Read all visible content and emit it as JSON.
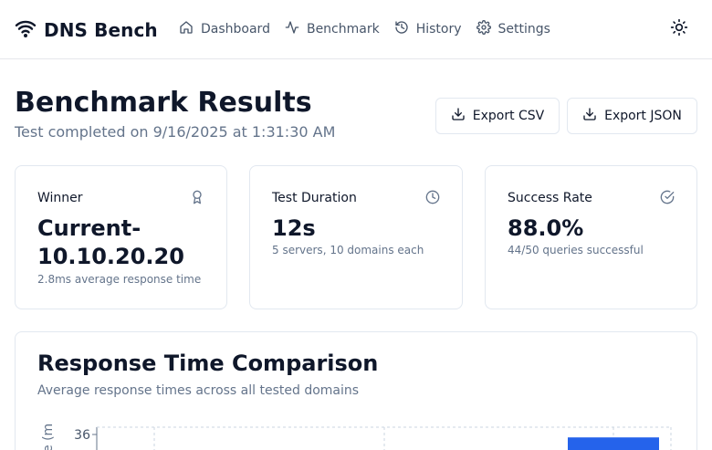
{
  "header": {
    "brand": "DNS Bench",
    "nav": [
      {
        "label": "Dashboard",
        "icon": "home-icon"
      },
      {
        "label": "Benchmark",
        "icon": "activity-icon"
      },
      {
        "label": "History",
        "icon": "history-icon"
      },
      {
        "label": "Settings",
        "icon": "gear-icon"
      }
    ],
    "theme_icon": "sun-icon"
  },
  "page": {
    "title": "Benchmark Results",
    "subtitle": "Test completed on 9/16/2025 at 1:31:30 AM"
  },
  "actions": {
    "export_csv": "Export CSV",
    "export_json": "Export JSON"
  },
  "cards": {
    "winner": {
      "label": "Winner",
      "value": "Current-10.10.20.20",
      "note": "2.8ms average response time",
      "icon": "award-icon"
    },
    "duration": {
      "label": "Test Duration",
      "value": "12s",
      "note": "5 servers, 10 domains each",
      "icon": "clock-icon"
    },
    "success": {
      "label": "Success Rate",
      "value": "88.0%",
      "note": "44/50 queries successful",
      "icon": "check-circle-icon"
    }
  },
  "chart": {
    "title": "Response Time Comparison",
    "subtitle": "Average response times across all tested domains",
    "ylabel_partial": "e (m",
    "accent_color": "#2563eb"
  },
  "chart_data": {
    "type": "bar",
    "title": "Response Time Comparison",
    "subtitle": "Average response times across all tested domains",
    "ylabel": "",
    "yticks_visible": [
      36
    ],
    "categories": [],
    "values": [],
    "partial_bar_value": 35
  },
  "colors": {
    "text_primary": "#0f172a",
    "text_muted": "#64748b",
    "border": "#e2e8f0",
    "bar": "#2563eb"
  }
}
